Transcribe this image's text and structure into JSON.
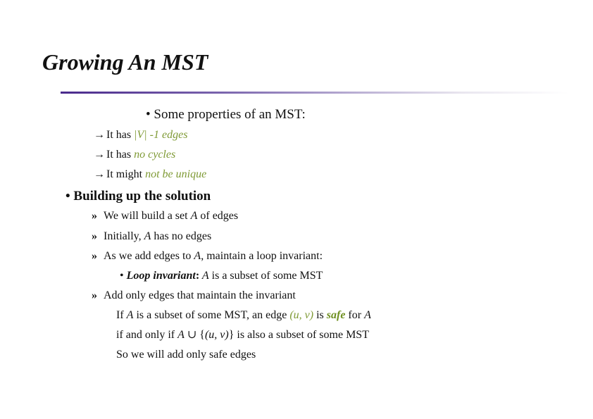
{
  "title": "Growing An MST",
  "properties": {
    "bullet": "•",
    "heading": "Some properties of an MST:",
    "arrow": "→",
    "items": [
      {
        "prefix": "It has ",
        "emph": "|V| -1 edges"
      },
      {
        "prefix": "It has ",
        "emph": "no cycles"
      },
      {
        "prefix": "It might ",
        "emph": "not be unique"
      }
    ]
  },
  "building": {
    "bullet": "•",
    "heading": "Building up the solution",
    "marker": "»",
    "item1": {
      "a": "We will build a set ",
      "var": "A",
      "b": " of edges"
    },
    "item2": {
      "a": "Initially, ",
      "var": "A",
      "b": " has no edges"
    },
    "item3": {
      "a": "As we add edges to ",
      "var": "A",
      "b": ", maintain a loop invariant:"
    },
    "invariant": {
      "bullet": "•",
      "label": "Loop invariant",
      "colon": ":",
      "var": " A",
      "rest": " is a subset of some MST"
    },
    "item4": {
      "text": "Add only edges that maintain the invariant"
    },
    "def1": {
      "a": "If ",
      "var": "A",
      "b": " is a subset of some MST, an edge ",
      "edge": "(u, v)",
      "c": " is ",
      "safe": "safe",
      "d": " for ",
      "var2": "A"
    },
    "def2": {
      "a": "if and only if ",
      "var": "A",
      "b": " ∪ {",
      "edge": "(u, v)",
      "c": "} is also a subset of some MST"
    },
    "conclusion": "So we will add only safe edges"
  },
  "colors": {
    "accent_green": "#7f9a35",
    "rule_purple": "#4a2a8c"
  }
}
